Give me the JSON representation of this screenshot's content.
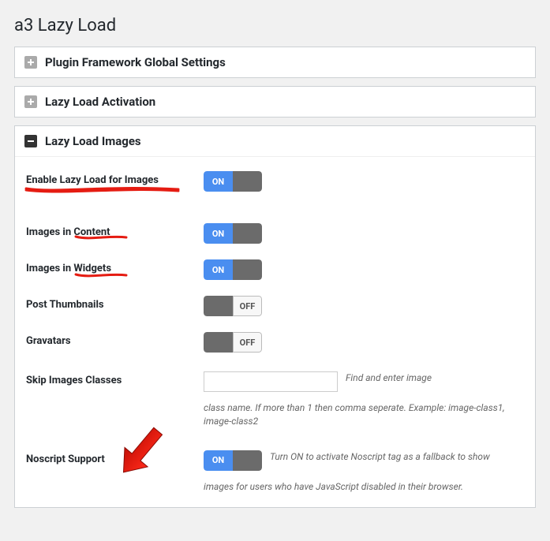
{
  "page_title": "a3 Lazy Load",
  "panels": {
    "framework": {
      "title": "Plugin Framework Global Settings"
    },
    "activation": {
      "title": "Lazy Load Activation"
    },
    "images": {
      "title": "Lazy Load Images"
    }
  },
  "toggle_labels": {
    "on": "ON",
    "off": "OFF"
  },
  "settings": {
    "enable_images": {
      "label": "Enable Lazy Load for Images",
      "state": "on"
    },
    "images_content": {
      "label": "Images in Content",
      "state": "on"
    },
    "images_widgets": {
      "label": "Images in Widgets",
      "state": "on"
    },
    "post_thumbnails": {
      "label": "Post Thumbnails",
      "state": "off"
    },
    "gravatars": {
      "label": "Gravatars",
      "state": "off"
    },
    "skip_classes": {
      "label": "Skip Images Classes",
      "value": "",
      "placeholder": "",
      "help_inline": "Find and enter image",
      "help_block": "class name. If more than 1 then comma seperate. Example: image-class1, image-class2"
    },
    "noscript": {
      "label": "Noscript Support",
      "state": "on",
      "help_inline": "Turn ON to activate Noscript tag as a fallback to show",
      "help_block": "images for users who have JavaScript disabled in their browser."
    }
  }
}
